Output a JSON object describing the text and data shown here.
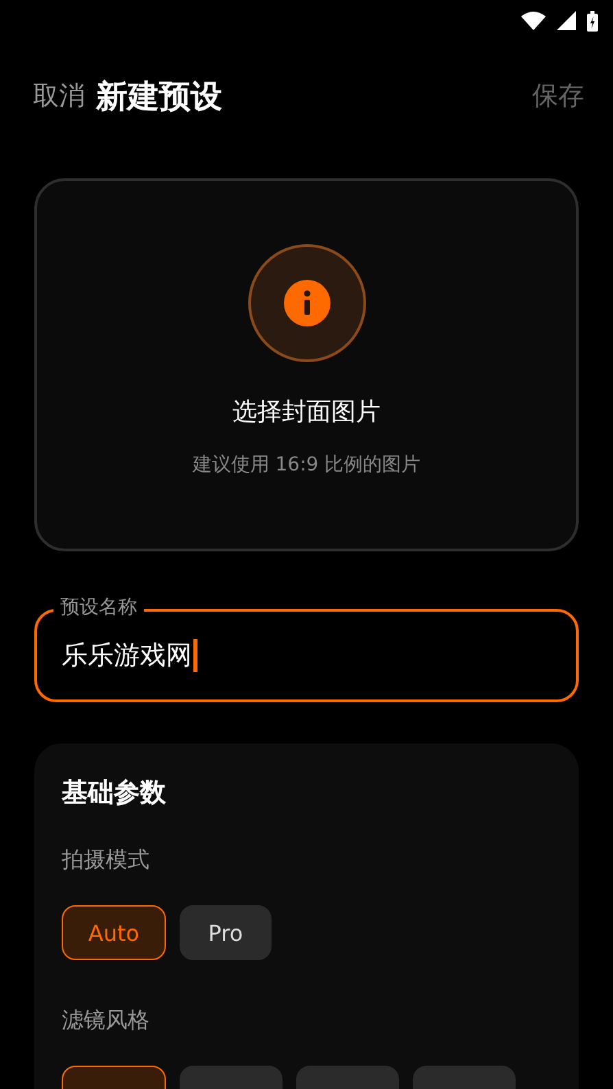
{
  "header": {
    "cancel": "取消",
    "title": "新建预设",
    "save": "保存"
  },
  "cover": {
    "title": "选择封面图片",
    "hint": "建议使用 16:9 比例的图片"
  },
  "name_field": {
    "label": "预设名称",
    "value": "乐乐游戏网"
  },
  "basic_params": {
    "title": "基础参数",
    "shooting_mode": {
      "label": "拍摄模式",
      "options": [
        {
          "label": "Auto",
          "selected": true
        },
        {
          "label": "Pro",
          "selected": false
        }
      ]
    },
    "filter_style": {
      "label": "滤镜风格",
      "options": [
        {
          "selected": true
        },
        {
          "selected": false
        },
        {
          "selected": false
        },
        {
          "selected": false
        }
      ]
    }
  }
}
